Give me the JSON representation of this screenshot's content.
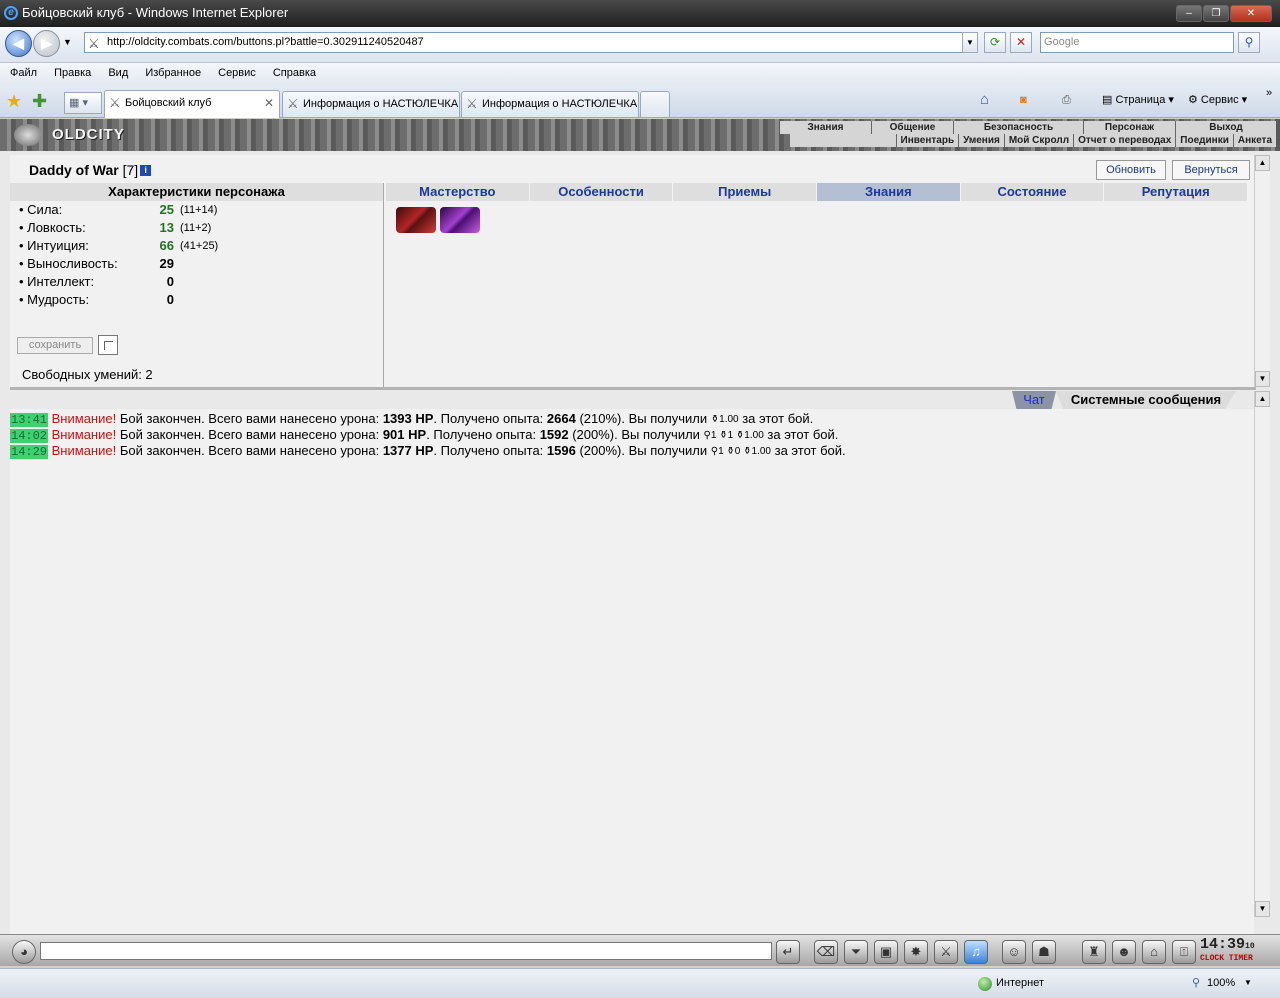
{
  "window": {
    "title": "Бойцовский клуб - Windows Internet Explorer",
    "ie_icon": "ie-logo-icon",
    "buttons": [
      "–",
      "❐",
      "✕"
    ]
  },
  "address_bar": {
    "url": "http://oldcity.combats.com/buttons.pl?battle=0.302911240520487",
    "search_placeholder": "Google"
  },
  "menu": [
    "Файл",
    "Правка",
    "Вид",
    "Избранное",
    "Сервис",
    "Справка"
  ],
  "tabs": [
    {
      "label": "Бойцовский клуб",
      "active": true
    },
    {
      "label": "Информация о НАСТЮЛЕЧКА",
      "active": false
    },
    {
      "label": "Информация о НАСТЮЛЕЧКА",
      "active": false
    }
  ],
  "toolbar_right": {
    "page": "Страница",
    "tools": "Сервис"
  },
  "game_menu": {
    "logo": "OLDCITY",
    "top": [
      "Знания",
      "Общение",
      "Безопасность",
      "Персонаж",
      "Выход"
    ],
    "sub": [
      "Инвентарь",
      "Умения",
      "Мой Скролл",
      "Отчет о переводах",
      "Поединки",
      "Анкета"
    ]
  },
  "character": {
    "name": "Daddy of War",
    "level": "[7]",
    "info_icon": "i",
    "refresh_label": "Обновить",
    "back_label": "Вернуться",
    "stats_header": "Характеристики персонажа",
    "stats": [
      {
        "name": "Сила:",
        "value": "25",
        "extra": "(11+14)",
        "green": true
      },
      {
        "name": "Ловкость:",
        "value": "13",
        "extra": "(11+2)",
        "green": true
      },
      {
        "name": "Интуиция:",
        "value": "66",
        "extra": "(41+25)",
        "green": true
      },
      {
        "name": "Выносливость:",
        "value": "29",
        "extra": "",
        "green": false
      },
      {
        "name": "Интеллект:",
        "value": "0",
        "extra": "",
        "green": false
      },
      {
        "name": "Мудрость:",
        "value": "0",
        "extra": "",
        "green": false
      }
    ],
    "save_label": "сохранить",
    "free_skills": "Свободных умений: 2"
  },
  "skill_tabs": [
    {
      "label": "Мастерство",
      "selected": false
    },
    {
      "label": "Особенности",
      "selected": false
    },
    {
      "label": "Приемы",
      "selected": false
    },
    {
      "label": "Знания",
      "selected": true
    },
    {
      "label": "Состояние",
      "selected": false
    },
    {
      "label": "Репутация",
      "selected": false
    }
  ],
  "chat_tabs": {
    "chat": "Чат",
    "system": "Системные сообщения"
  },
  "log": [
    {
      "time": "13:41",
      "warn": "Внимание!",
      "a": " Бой закончен. Всего вами нанесено урона: ",
      "dmg": "1393 HP",
      "b": ". Получено опыта: ",
      "exp": "2664",
      "c": " (210%). Вы получили ",
      "reward": "⚱1.00",
      "d": " за этот бой."
    },
    {
      "time": "14:02",
      "warn": "Внимание!",
      "a": " Бой закончен. Всего вами нанесено урона: ",
      "dmg": "901 HP",
      "b": ". Получено опыта: ",
      "exp": "1592",
      "c": " (200%). Вы получили ",
      "reward": "⚲1 ⚱1 ⚱1.00",
      "d": " за этот бой."
    },
    {
      "time": "14:29",
      "warn": "Внимание!",
      "a": " Бой закончен. Всего вами нанесено урона: ",
      "dmg": "1377 HP",
      "b": ". Получено опыта: ",
      "exp": "1596",
      "c": " (200%). Вы получили ",
      "reward": "⚲1 ⚱0 ⚱1.00",
      "d": " за этот бой."
    }
  ],
  "clock": {
    "time": "14:39",
    "sec": "10",
    "label": "CLOCK TIMER"
  },
  "statusbar": {
    "zone": "Интернет",
    "zoom": "100%"
  }
}
